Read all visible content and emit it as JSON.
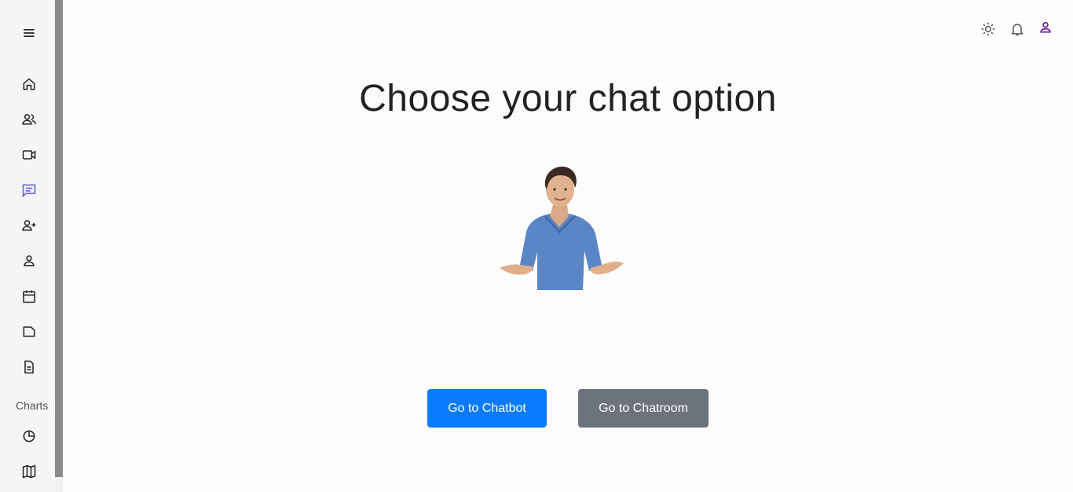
{
  "sidebar": {
    "menu_icon": "menu-icon",
    "items": [
      {
        "icon": "home-icon"
      },
      {
        "icon": "users-icon"
      },
      {
        "icon": "video-icon"
      },
      {
        "icon": "chat-icon",
        "active": true
      },
      {
        "icon": "add-user-icon"
      },
      {
        "icon": "person-icon"
      },
      {
        "icon": "calendar-icon"
      },
      {
        "icon": "folder-icon"
      },
      {
        "icon": "document-icon"
      }
    ],
    "section_label": "Charts",
    "chart_items": [
      {
        "icon": "pie-chart-icon"
      },
      {
        "icon": "map-icon"
      }
    ],
    "active_color": "#5b5bd6"
  },
  "topbar": {
    "icons": [
      "theme-toggle-icon",
      "notification-bell-icon",
      "account-icon"
    ],
    "account_color": "#6a1b9a"
  },
  "main": {
    "title": "Choose your chat option",
    "chatbot_button": "Go to Chatbot",
    "chatroom_button": "Go to Chatroom"
  },
  "colors": {
    "primary": "#0a7bff",
    "secondary": "#6c737c"
  }
}
